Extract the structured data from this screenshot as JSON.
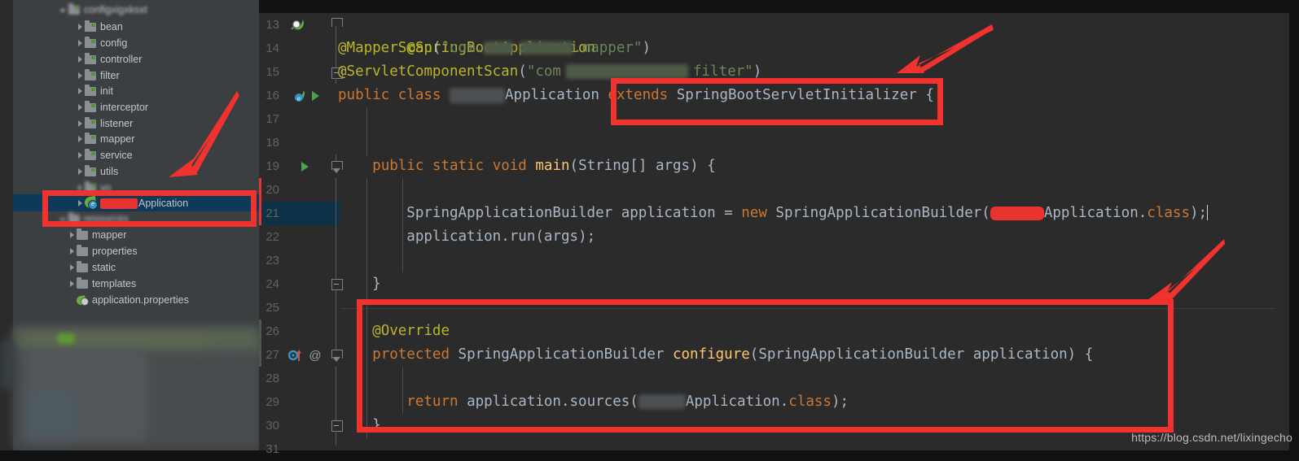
{
  "app": {
    "theme": "darcula",
    "accent_red": "#f2322e",
    "editor_bg": "#2b2b2b",
    "sidebar_bg": "#3c3f41",
    "selection_bg": "#0d3a58"
  },
  "sidebar": {
    "name": "project-tree",
    "items": [
      {
        "label": "configxigxksxt",
        "icon": "folder-icon",
        "expanded": true,
        "depth": 1,
        "blurred": true,
        "selected": false
      },
      {
        "label": "bean",
        "icon": "folder-icon",
        "expanded": false,
        "depth": 2,
        "blurred": false,
        "selected": false
      },
      {
        "label": "config",
        "icon": "folder-icon",
        "expanded": false,
        "depth": 2,
        "blurred": false,
        "selected": false
      },
      {
        "label": "controller",
        "icon": "folder-icon",
        "expanded": false,
        "depth": 2,
        "blurred": false,
        "selected": false
      },
      {
        "label": "filter",
        "icon": "folder-icon",
        "expanded": false,
        "depth": 2,
        "blurred": false,
        "selected": false
      },
      {
        "label": "init",
        "icon": "folder-icon",
        "expanded": false,
        "depth": 2,
        "blurred": false,
        "selected": false
      },
      {
        "label": "interceptor",
        "icon": "folder-icon",
        "expanded": false,
        "depth": 2,
        "blurred": false,
        "selected": false
      },
      {
        "label": "listener",
        "icon": "folder-icon",
        "expanded": false,
        "depth": 2,
        "blurred": false,
        "selected": false
      },
      {
        "label": "mapper",
        "icon": "folder-icon",
        "expanded": false,
        "depth": 2,
        "blurred": false,
        "selected": false
      },
      {
        "label": "service",
        "icon": "folder-icon",
        "expanded": false,
        "depth": 2,
        "blurred": false,
        "selected": false
      },
      {
        "label": "utils",
        "icon": "folder-icon",
        "expanded": false,
        "depth": 2,
        "blurred": false,
        "selected": false
      },
      {
        "label": "vo",
        "icon": "folder-icon",
        "expanded": false,
        "depth": 2,
        "blurred": true,
        "selected": false
      },
      {
        "label": "Application",
        "icon": "spring-boot-class-icon",
        "expanded": false,
        "depth": 2,
        "blurred": false,
        "selected": true,
        "redacted_prefix": true
      },
      {
        "label": "resources",
        "icon": "folder-icon",
        "expanded": true,
        "depth": 1,
        "blurred": true,
        "selected": false
      },
      {
        "label": "mapper",
        "icon": "folder-icon",
        "expanded": false,
        "depth": 2,
        "blurred": false,
        "selected": false
      },
      {
        "label": "properties",
        "icon": "folder-icon",
        "expanded": false,
        "depth": 2,
        "blurred": false,
        "selected": false
      },
      {
        "label": "static",
        "icon": "folder-icon",
        "expanded": false,
        "depth": 2,
        "blurred": false,
        "selected": false
      },
      {
        "label": "templates",
        "icon": "folder-icon",
        "expanded": false,
        "depth": 2,
        "blurred": false,
        "selected": false
      },
      {
        "label": "application.properties",
        "icon": "spring-properties-icon",
        "expanded": null,
        "depth": 2,
        "blurred": false,
        "selected": false
      }
    ]
  },
  "editor": {
    "name": "java-editor",
    "language": "java",
    "lines": [
      {
        "num": "13",
        "text": "@SpringBootApplication"
      },
      {
        "num": "14",
        "text": "@MapperScan(\"com.████.██████.mapper\")"
      },
      {
        "num": "15",
        "text": "@ServletComponentScan(\"com█████████filter\")"
      },
      {
        "num": "16",
        "text": "public class █████Application extends SpringBootServletInitializer {"
      },
      {
        "num": "17",
        "text": ""
      },
      {
        "num": "18",
        "text": ""
      },
      {
        "num": "19",
        "text": "    public static void main(String[] args) {"
      },
      {
        "num": "20",
        "text": ""
      },
      {
        "num": "21",
        "text": "        SpringApplicationBuilder application = new SpringApplicationBuilder(█████Application.class);"
      },
      {
        "num": "22",
        "text": "        application.run(args);"
      },
      {
        "num": "23",
        "text": ""
      },
      {
        "num": "24",
        "text": "    }"
      },
      {
        "num": "25",
        "text": ""
      },
      {
        "num": "26",
        "text": "    @Override"
      },
      {
        "num": "27",
        "text": "    protected SpringApplicationBuilder configure(SpringApplicationBuilder application) {"
      },
      {
        "num": "28",
        "text": ""
      },
      {
        "num": "29",
        "text": "        return application.sources(█████Application.class);"
      },
      {
        "num": "30",
        "text": "    }"
      },
      {
        "num": "31",
        "text": ""
      }
    ],
    "tokens": {
      "ann_spring_boot_application": "@SpringBootApplication",
      "ann_mapper_scan": "@MapperScan",
      "str_com_dot": "\"com.",
      "str_dot_mapper": ".mapper\"",
      "ann_servlet_component_scan": "@ServletComponentScan",
      "str_com": "\"com",
      "str_filter": "filter\"",
      "kw_public": "public",
      "kw_class": "class",
      "cls_application": "Application",
      "kw_extends": "extends",
      "cls_spring_boot_servlet_initializer": "SpringBootServletInitializer",
      "brace_open": "{",
      "brace_close": "}",
      "kw_static": "static",
      "kw_void": "void",
      "mth_main": "main",
      "cls_string_array": "String[]",
      "var_args": "args",
      "cls_spring_application_builder": "SpringApplicationBuilder",
      "var_application": "application",
      "op_assign": "=",
      "kw_new": "new",
      "kw_class_literal": "class",
      "mth_run": "run",
      "ann_override": "@Override",
      "kw_protected": "protected",
      "mth_configure": "configure",
      "kw_return": "return",
      "mth_sources": "sources"
    },
    "gutter_icons": {
      "line13": "spring-bean-search-icon",
      "line16": "spring-boot-run-icon",
      "line16_run": "run-triangle-icon",
      "line19_run": "run-triangle-icon",
      "line27_override": "overriding-method-icon",
      "line27_annotation": "annotation-at-icon"
    },
    "current_line": "21",
    "caret_line": "21"
  },
  "annotations": {
    "name": "red-markup-overlay",
    "color": "#f2322e",
    "boxes": [
      {
        "name": "highlight-extends-clause",
        "label": "extends SpringBootServletInitializer"
      },
      {
        "name": "highlight-selected-class",
        "label": "Application (project tree)"
      },
      {
        "name": "highlight-configure-method",
        "label": "@Override configure(...) block"
      }
    ],
    "arrows": [
      {
        "name": "arrow-to-extends-clause",
        "direction": "down-left"
      },
      {
        "name": "arrow-to-tree-application",
        "direction": "down-left"
      },
      {
        "name": "arrow-to-configure-method",
        "direction": "down-left"
      }
    ]
  },
  "watermark": {
    "text": "https://blog.csdn.net/lixingecho"
  }
}
